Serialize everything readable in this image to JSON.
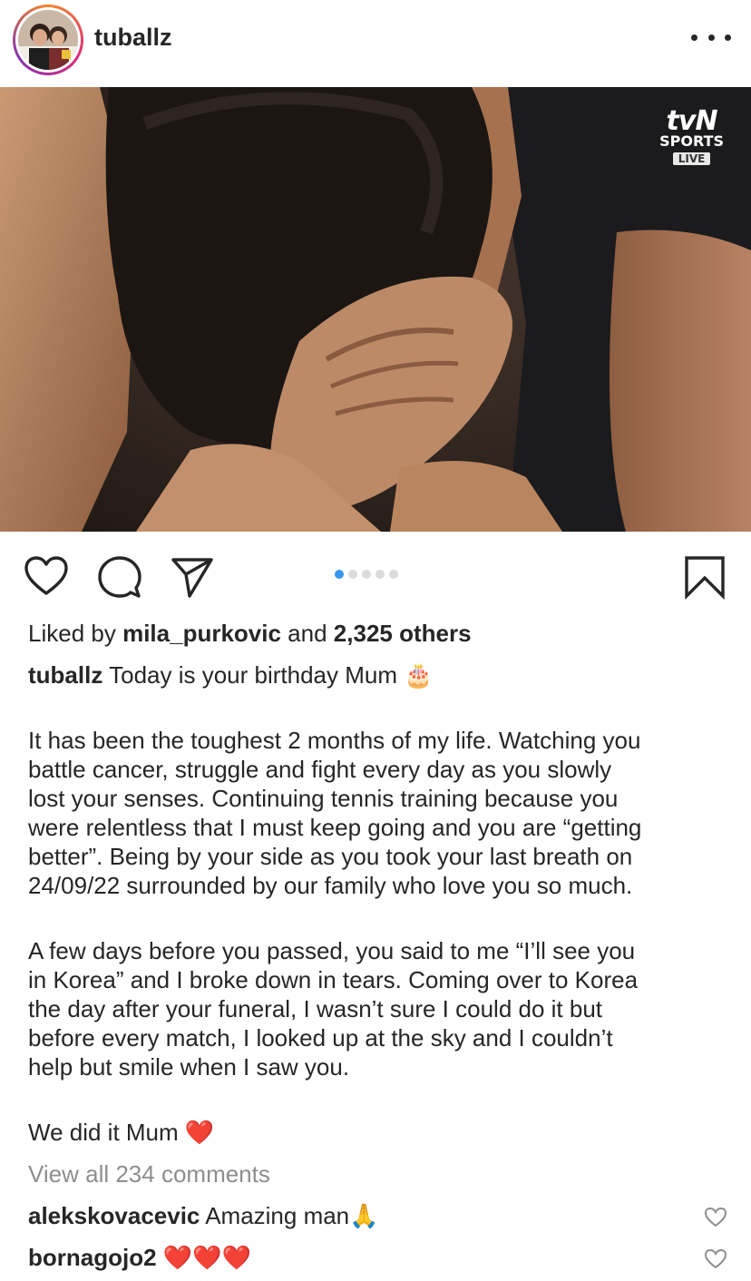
{
  "header": {
    "username": "tuballz"
  },
  "photo": {
    "overlay_logo": "tvN",
    "overlay_sports": "SPORTS",
    "overlay_live": "LIVE"
  },
  "actions": {
    "icons": [
      "heart-icon",
      "comment-icon",
      "share-icon",
      "bookmark-icon"
    ],
    "carousel_pages": 5,
    "carousel_active": 1
  },
  "likes": {
    "prefix": "Liked by",
    "user": "mila_purkovic",
    "conjunction": "and",
    "others": "2,325 others"
  },
  "caption": {
    "username": "tuballz",
    "first_line": "Today is your birthday Mum",
    "first_line_emoji": "🎂",
    "paragraph1": [
      "It has been the toughest 2 months of my life. Watching you",
      "battle cancer, struggle and fight every day as you slowly",
      "lost your senses. Continuing tennis training because you",
      "were relentless that I must keep going and you are “getting",
      "better”. Being by your side as you took your last breath on",
      "24/09/22 surrounded by our family who love you so much."
    ],
    "paragraph2": [
      "A few days before you passed, you said to me “I’ll see you",
      "in Korea” and I broke down in tears. Coming over to Korea",
      "the day after your funeral, I wasn’t sure I could do it but",
      "before every match, I looked up at the sky and I couldn’t",
      "help but smile when I saw you."
    ],
    "closing": "We did it Mum",
    "closing_emoji": "❤️"
  },
  "view_comments": "View all 234 comments",
  "comments": [
    {
      "username": "alekskovacevic",
      "text": "Amazing man",
      "emoji": "🙏"
    },
    {
      "username": "bornagojo2",
      "text": "",
      "emoji": "❤️❤️❤️"
    }
  ],
  "colors": {
    "text": "#262626",
    "muted": "#8e8e8e",
    "accent": "#3897f0",
    "heart_red": "#e0102a"
  }
}
